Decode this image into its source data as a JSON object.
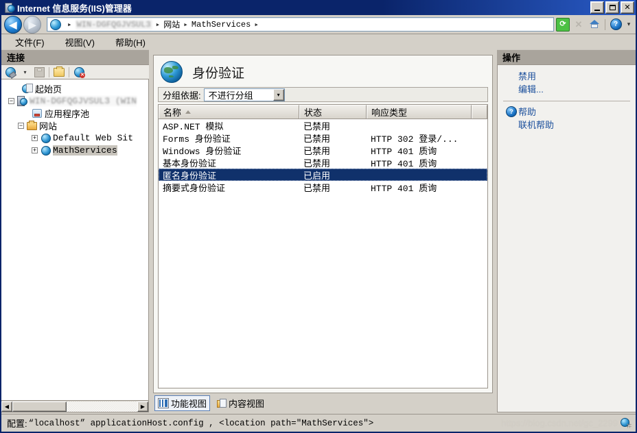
{
  "window": {
    "title": "Internet 信息服务(IIS)管理器",
    "icon": "iis-server-icon",
    "minimize_label": "_",
    "maximize_label": "□",
    "close_label": "✕"
  },
  "address_bar": {
    "back_icon": "back-arrow-icon",
    "forward_icon": "forward-arrow-icon",
    "site_icon": "globe-icon",
    "breadcrumbs": [
      {
        "label": "WIN-DGFQGJVSUL3",
        "blurred": true
      },
      {
        "label": "网站",
        "blurred": false
      },
      {
        "label": "MathServices",
        "blurred": false
      }
    ],
    "separator": "▸",
    "refresh_icon": "refresh-icon",
    "stop_icon": "stop-icon",
    "home_icon": "home-icon",
    "help_icon": "help-icon",
    "help_caret": "▾"
  },
  "menu": {
    "items": [
      {
        "label": "文件(F)"
      },
      {
        "label": "视图(V)"
      },
      {
        "label": "帮助(H)"
      }
    ]
  },
  "connections": {
    "header": "连接",
    "toolbar": [
      {
        "name": "connect-icon",
        "caret": "▾"
      },
      {
        "name": "save-icon"
      },
      {
        "name": "open-folder-icon"
      },
      {
        "name": "disconnect-icon"
      }
    ],
    "tree": [
      {
        "label": "起始页",
        "icon": "start-page-icon",
        "expander": "",
        "indent": 1,
        "selected": false,
        "blurred": false
      },
      {
        "label": "WIN-DGFQGJVSUL3 (WIN",
        "icon": "server-icon",
        "expander": "−",
        "indent": 0,
        "selected": false,
        "blurred": true
      },
      {
        "label": "应用程序池",
        "icon": "app-pool-icon",
        "expander": "",
        "indent": 2,
        "selected": false,
        "blurred": false
      },
      {
        "label": "网站",
        "icon": "sites-folder-icon",
        "expander": "−",
        "indent": 1,
        "selected": false,
        "blurred": false
      },
      {
        "label": "Default Web Sit",
        "icon": "website-icon",
        "expander": "+",
        "indent": 2,
        "selected": false,
        "blurred": false
      },
      {
        "label": "MathServices",
        "icon": "website-icon",
        "expander": "+",
        "indent": 2,
        "selected": true,
        "blurred": false
      }
    ],
    "scroll_left_arrow": "◀",
    "scroll_right_arrow": "▶"
  },
  "content": {
    "title": "身份验证",
    "title_icon": "authentication-globe-icon",
    "group_by_label": "分组依据:",
    "group_by_value": "不进行分组",
    "group_by_caret": "▾",
    "columns": [
      {
        "label": "名称",
        "sorted": "asc"
      },
      {
        "label": "状态",
        "sorted": ""
      },
      {
        "label": "响应类型",
        "sorted": ""
      },
      {
        "label": "",
        "sorted": ""
      }
    ],
    "rows": [
      {
        "name": "ASP.NET 模拟",
        "status": "已禁用",
        "response": "",
        "selected": false
      },
      {
        "name": "Forms 身份验证",
        "status": "已禁用",
        "response": "HTTP 302 登录/...",
        "selected": false
      },
      {
        "name": "Windows 身份验证",
        "status": "已禁用",
        "response": "HTTP 401 质询",
        "selected": false
      },
      {
        "name": "基本身份验证",
        "status": "已禁用",
        "response": "HTTP 401 质询",
        "selected": false
      },
      {
        "name": "匿名身份验证",
        "status": "已启用",
        "response": "",
        "selected": true
      },
      {
        "name": "摘要式身份验证",
        "status": "已禁用",
        "response": "HTTP 401 质询",
        "selected": false
      }
    ],
    "view_tabs": [
      {
        "label": "功能视图",
        "icon": "features-view-icon",
        "active": true
      },
      {
        "label": "内容视图",
        "icon": "content-view-icon",
        "active": false
      }
    ]
  },
  "actions": {
    "header": "操作",
    "items": [
      {
        "label": "禁用",
        "icon": "",
        "group": 1
      },
      {
        "label": "编辑...",
        "icon": "",
        "group": 1
      },
      {
        "label": "帮助",
        "icon": "help-icon",
        "group": 2
      },
      {
        "label": "联机帮助",
        "icon": "",
        "group": 2
      }
    ]
  },
  "status": {
    "prefix": "配置:",
    "text": "“localhost” applicationHost.config ,  <location path=\"MathServices\">",
    "watermark": "https://blog.csdn.net/gc_2299",
    "resize_icon": "resize-grip-icon"
  },
  "colors": {
    "title_bar": "#0a246a",
    "selection": "#10316b",
    "link": "#1b4f9c",
    "pane_header": "#a9a49c",
    "window_bg": "#d4d0c8"
  }
}
